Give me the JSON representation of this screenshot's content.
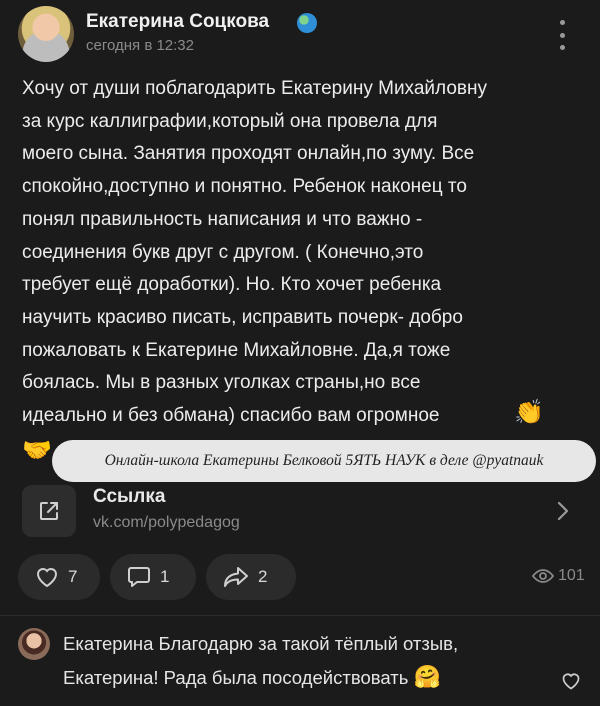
{
  "post": {
    "author": "Екатерина Соцкова",
    "time": "сегодня в 12:32",
    "text_lines": [
      "Хочу от души поблагодарить Екатерину Михайловну",
      "за курс каллиграфии,который она провела для",
      "моего сына. Занятия проходят онлайн,по зуму. Все",
      "спокойно,доступно и понятно. Ребенок наконец то",
      "понял правильность написания и что важно -",
      "соединения букв друг с другом. ( Конечно,это",
      "требует ещё доработки). Но. Кто хочет ребенка",
      "научить красиво писать, исправить почерк- добро",
      "пожаловать к Екатерине Михайловне. Да,я тоже",
      "боялась. Мы в разных уголках страны,но все",
      "идеально и без обмана) спасибо вам огромное"
    ],
    "emoji_clap": "👏",
    "emoji_handshake": "🤝"
  },
  "overlay": {
    "text": "Онлайн-школа Екатерины Белковой 5ЯТЬ НАУК в деле @pyatnauk"
  },
  "link": {
    "title": "Ссылка",
    "url": "vk.com/polypedagog"
  },
  "actions": {
    "likes": "7",
    "comments": "1",
    "shares": "2",
    "views": "101"
  },
  "comment": {
    "author": "Екатерина",
    "line1_rest": " Благодарю за такой тёплый отзыв,",
    "line2": "Екатерина! Рада была посодействовать ",
    "emoji": "🤗"
  },
  "icons": {
    "more": "more-vertical-icon",
    "link": "external-link-icon",
    "chevron": "chevron-right-icon",
    "like": "heart-icon",
    "comment": "comment-icon",
    "share": "share-icon",
    "views": "eye-icon"
  },
  "colors": {
    "background": "#1b1b1b",
    "button_bg": "#2b2b2b",
    "muted_text": "#8a8a8a",
    "overlay_bg": "#e7e7e7"
  }
}
